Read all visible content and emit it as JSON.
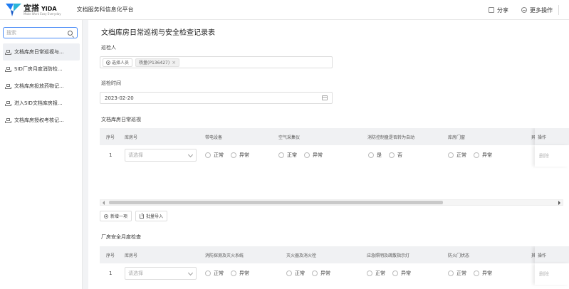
{
  "header": {
    "logo_cn": "宜搭",
    "logo_en": "YIDA",
    "logo_sub": "Make Work Easy Everyday",
    "app_title": "文档服务科信息化平台",
    "actions": [
      {
        "label": "分享",
        "icon": "share-icon"
      },
      {
        "label": "更多操作",
        "icon": "more-icon"
      }
    ]
  },
  "sidebar": {
    "search_placeholder": "搜索",
    "items": [
      {
        "label": "文档库房日常巡视与..."
      },
      {
        "label": "SID厂房月度消防检..."
      },
      {
        "label": "文档库房投放药物记..."
      },
      {
        "label": "进入SID文档库房报..."
      },
      {
        "label": "文档库房授权考核记..."
      }
    ]
  },
  "form": {
    "title": "文档库房日常巡视与安全检查记录表",
    "inspector_label": "巡检人",
    "select_person_label": "选择人员",
    "person_tag": "杨量(P136427)",
    "tag_close": "×",
    "date_label": "巡检时间",
    "date_value": "2023-02-20"
  },
  "table1": {
    "title": "文档库房日常巡视",
    "headers": {
      "seq": "序号",
      "room": "库房号",
      "col1": "带电设备",
      "col2": "空气采集仪",
      "col3": "消防控制盘是否转为自动",
      "col4": "库房门窗",
      "col5": "异",
      "action": "操作"
    },
    "row": {
      "seq": "1",
      "room_placeholder": "请选择",
      "opt_normal": "正常",
      "opt_abnormal": "异常",
      "opt_yes": "是",
      "opt_no": "否",
      "delete": "删除"
    }
  },
  "buttons": {
    "add": "新增一项",
    "import": "批量导入"
  },
  "table2": {
    "title": "厂房安全月度检查",
    "headers": {
      "seq": "序号",
      "room": "库房号",
      "col1": "消防探测及灭火系统",
      "col2": "灭火器及消火栓",
      "col3": "应急照明及疏散指示灯",
      "col4": "防火门状态",
      "col5": "其",
      "action": "操作"
    },
    "row": {
      "seq": "1",
      "room_placeholder": "请选择",
      "opt_normal": "正常",
      "opt_abnormal": "异常",
      "delete": "删除"
    }
  },
  "colors": {
    "brand_blue": "#1e7bf2",
    "brand_teal": "#2bb5d8",
    "focus_border": "#4a8cf7"
  }
}
